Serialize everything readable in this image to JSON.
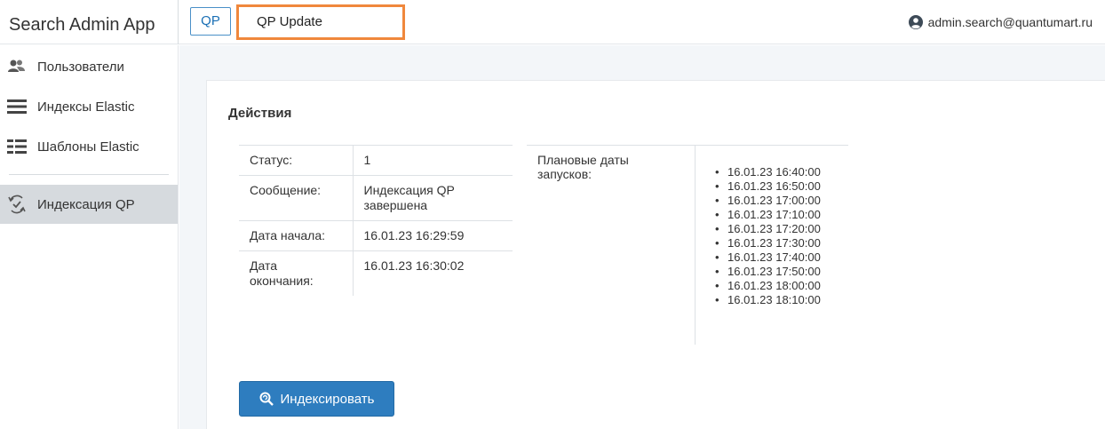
{
  "header": {
    "app_title": "Search Admin App",
    "tabs": [
      {
        "label": "QP"
      },
      {
        "label": "QP Update"
      }
    ],
    "user_email": "admin.search@quantumart.ru"
  },
  "sidebar": {
    "items": [
      {
        "label": "Пользователи",
        "icon": "users-icon"
      },
      {
        "label": "Индексы Elastic",
        "icon": "list-icon"
      },
      {
        "label": "Шаблоны Elastic",
        "icon": "template-list-icon"
      },
      {
        "label": "Индексация QP",
        "icon": "sync-check-icon",
        "active": true
      }
    ]
  },
  "main": {
    "section_title": "Действия",
    "status_table": [
      {
        "key": "Статус:",
        "value": "1"
      },
      {
        "key": "Сообщение:",
        "value": "Индексация QP завершена"
      },
      {
        "key": "Дата начала:",
        "value": "16.01.23 16:29:59"
      },
      {
        "key": "Дата окончания:",
        "value": "16.01.23 16:30:02"
      }
    ],
    "schedule_label": "Плановые даты запусков:",
    "schedule": [
      "16.01.23 16:40:00",
      "16.01.23 16:50:00",
      "16.01.23 17:00:00",
      "16.01.23 17:10:00",
      "16.01.23 17:20:00",
      "16.01.23 17:30:00",
      "16.01.23 17:40:00",
      "16.01.23 17:50:00",
      "16.01.23 18:00:00",
      "16.01.23 18:10:00"
    ],
    "index_button_label": "Индексировать"
  },
  "colors": {
    "accent": "#2e7dbf",
    "tab_highlight": "#f0883c",
    "sidebar_active": "#d6dade"
  }
}
